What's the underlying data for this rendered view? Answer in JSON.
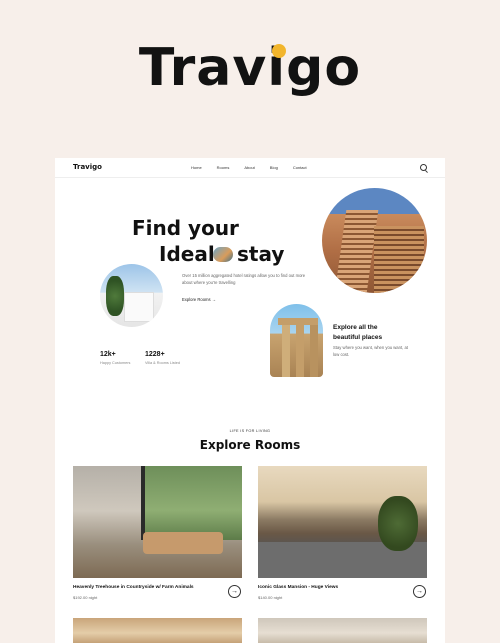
{
  "brand": {
    "logo_text": "Travigo",
    "dot_color": "#f2b52c"
  },
  "nav": {
    "brand": "Travigo",
    "links": [
      "Home",
      "Rooms",
      "About",
      "Blog",
      "Contact"
    ]
  },
  "hero": {
    "title_line1": "Find your",
    "title_line2a": "Ideal",
    "title_line2b": "stay",
    "description": "Over 15 million aggregated hotel ratings allow you to find out more about where you're travelling",
    "link": "Explore Rooms →"
  },
  "explore": {
    "title": "Explore all the beautiful places",
    "description": "Stay where you want, when you want, at low cost."
  },
  "stats": [
    {
      "value": "12k+",
      "label": "Happy Customers"
    },
    {
      "value": "1228+",
      "label": "Villa & Rooms Listed"
    }
  ],
  "rooms": {
    "eyebrow": "LIFE IS FOR LIVING",
    "title": "Explore Rooms",
    "cards": [
      {
        "title": "Heavenly Treehouse in Countryside w/ Farm Animals",
        "price": "$192.00 night"
      },
      {
        "title": "Iconic Glass Mansion - Huge Views",
        "price": "$140.00 night"
      }
    ]
  }
}
